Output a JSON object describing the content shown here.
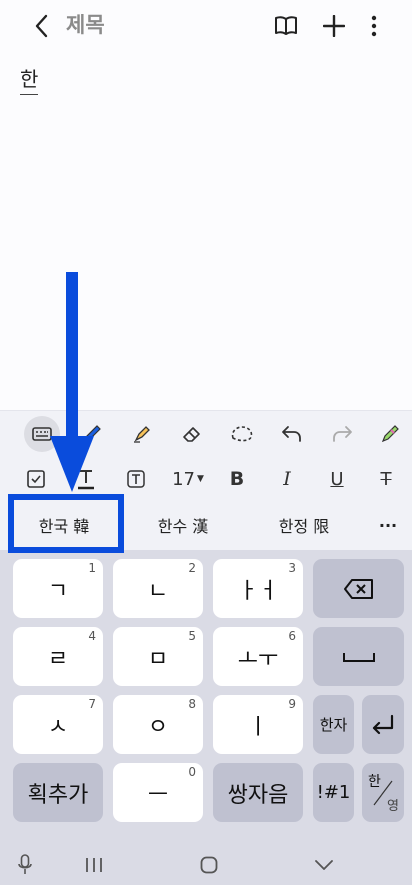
{
  "header": {
    "title": "제목",
    "back_icon": "chevron-left-icon",
    "reading_mode_icon": "book-icon",
    "add_icon": "plus-icon",
    "more_icon": "more-vertical-icon"
  },
  "note": {
    "content": "한"
  },
  "toolbar": {
    "tools": [
      "keyboard-icon",
      "pen-icon",
      "highlighter-icon",
      "eraser-icon",
      "lasso-icon",
      "undo-icon",
      "redo-icon",
      "color-picker-icon"
    ],
    "font_size": "17",
    "bold": "B",
    "italic": "I",
    "underline": "U",
    "strike": "T"
  },
  "suggestions": [
    "한국 韓",
    "한수 漢",
    "한정 限",
    "···"
  ],
  "keyboard": {
    "row1": [
      {
        "label": "ㄱ",
        "num": "1"
      },
      {
        "label": "ㄴ",
        "num": "2"
      },
      {
        "label": "ㅏㅓ",
        "num": "3"
      }
    ],
    "row2": [
      {
        "label": "ㄹ",
        "num": "4"
      },
      {
        "label": "ㅁ",
        "num": "5"
      },
      {
        "label": "ㅗㅜ",
        "num": "6"
      }
    ],
    "row3": [
      {
        "label": "ㅅ",
        "num": "7"
      },
      {
        "label": "ㅇ",
        "num": "8"
      },
      {
        "label": "ㅣ",
        "num": "9"
      }
    ],
    "row4": [
      {
        "label": "획추가",
        "num": ""
      },
      {
        "label": "ㅡ",
        "num": "0"
      },
      {
        "label": "쌍자음",
        "num": ""
      }
    ],
    "hanja": "한자",
    "symbols": "!#1",
    "lang_top": "한",
    "lang_bottom": "영"
  },
  "colors": {
    "annotation": "#0a4cdc",
    "keyboard_bg": "#dadbe5",
    "func_key": "#bfc1d0"
  }
}
